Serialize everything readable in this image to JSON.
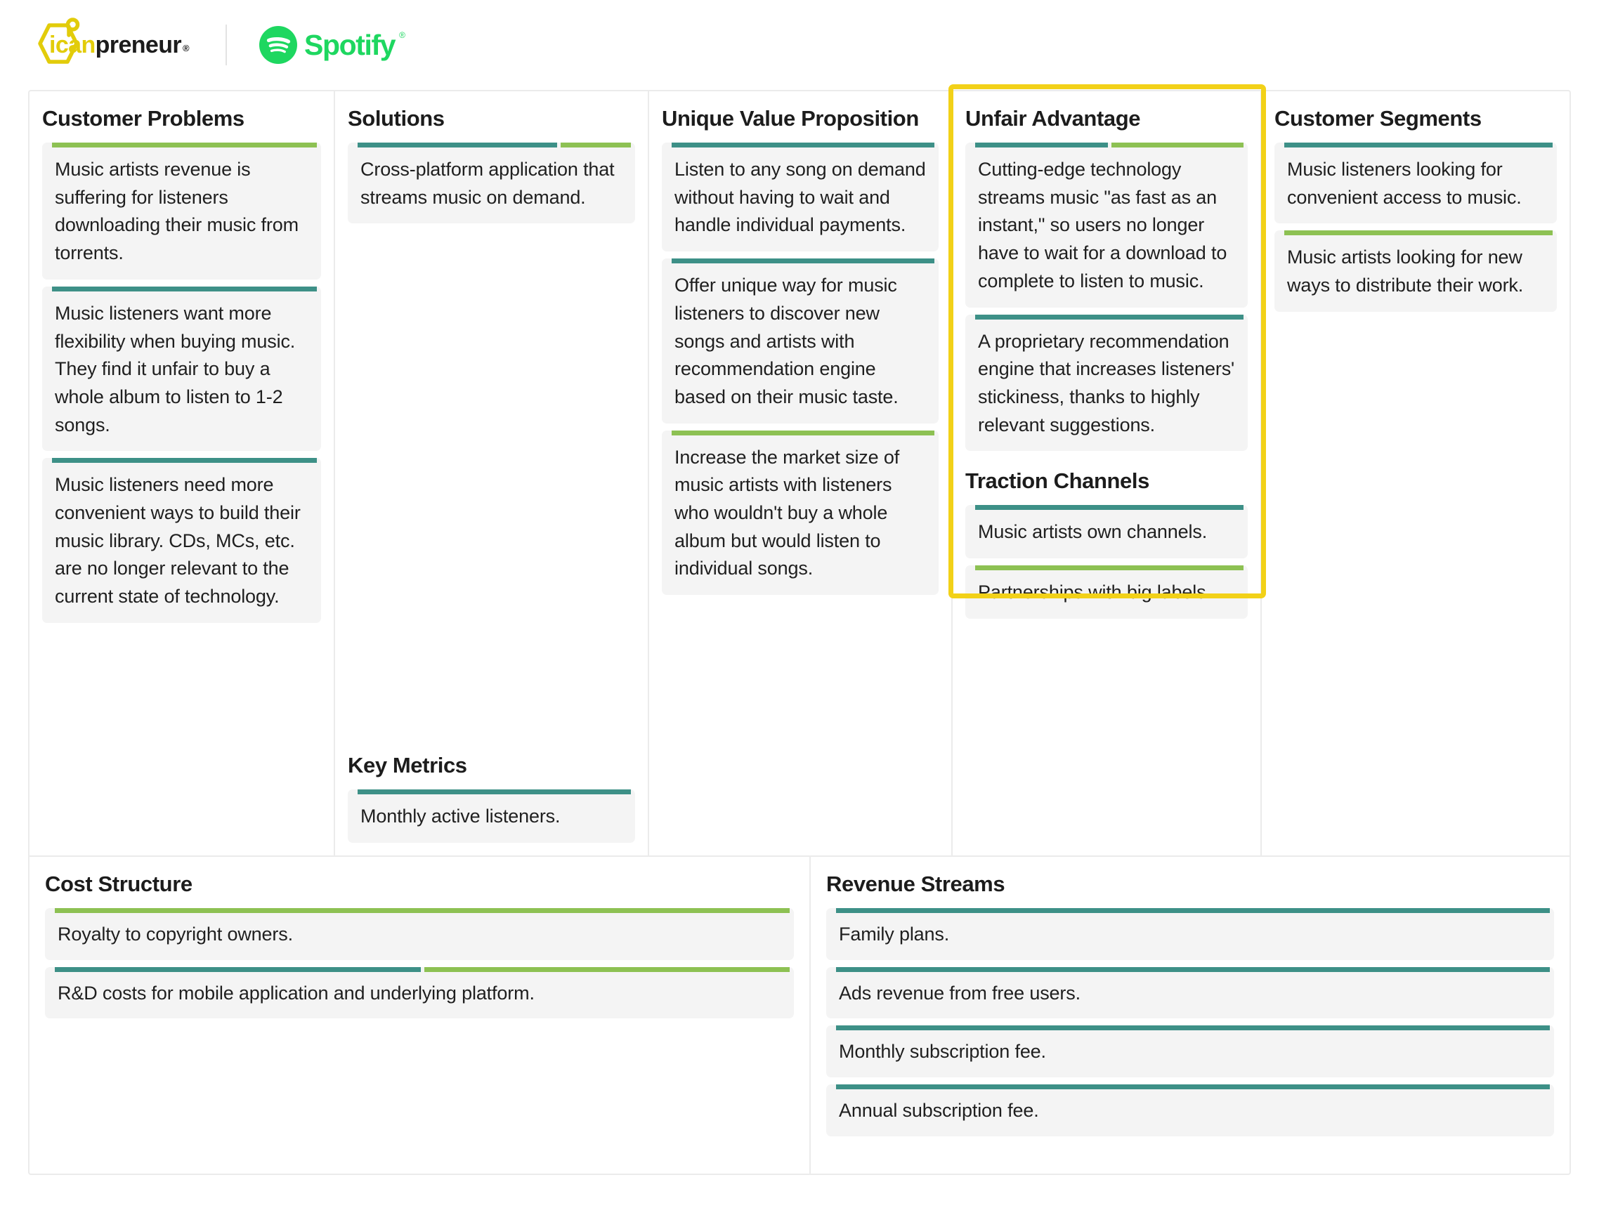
{
  "header": {
    "brand": {
      "part1": "ican",
      "part2": "preneur",
      "registered": "®",
      "icon": "hexagon-key-logo"
    },
    "company": {
      "name": "Spotify",
      "registered": "®",
      "icon": "spotify-icon"
    }
  },
  "colors": {
    "teal": "#3D9087",
    "green": "#8DC153",
    "highlight_yellow": "#F2D118",
    "brand_yellow": "#E2CC0A",
    "spotify_green": "#1ED760",
    "card_bg": "#f4f4f4",
    "grid_line": "#ebebeb"
  },
  "canvas": {
    "customer_problems": {
      "title": "Customer Problems",
      "cards": [
        {
          "text": "Music artists revenue is suffering for listeners downloading their music from torrents.",
          "bar": [
            {
              "color": "green",
              "flex": 1
            }
          ]
        },
        {
          "text": "Music listeners want more flexibility when buying music. They find it unfair to buy a whole album to listen to 1-2 songs.",
          "bar": [
            {
              "color": "teal",
              "flex": 1
            }
          ]
        },
        {
          "text": "Music listeners need more convenient ways to build their music library. CDs, MCs, etc. are no longer relevant to the current state of technology.",
          "bar": [
            {
              "color": "teal",
              "flex": 1
            }
          ]
        }
      ]
    },
    "solutions": {
      "title": "Solutions",
      "cards": [
        {
          "text": "Cross-platform application that streams music on demand.",
          "bar": [
            {
              "color": "teal",
              "flex": 74
            },
            {
              "color": "green",
              "flex": 26
            }
          ]
        }
      ]
    },
    "key_metrics": {
      "title": "Key Metrics",
      "cards": [
        {
          "text": "Monthly active listeners.",
          "bar": [
            {
              "color": "teal",
              "flex": 1
            }
          ]
        }
      ]
    },
    "unique_value_proposition": {
      "title": "Unique Value Proposition",
      "cards": [
        {
          "text": "Listen to any song on demand without having to wait and handle individual payments.",
          "bar": [
            {
              "color": "teal",
              "flex": 1
            }
          ]
        },
        {
          "text": "Offer unique way for music listeners to discover new songs and artists with recommendation engine based on their music taste.",
          "bar": [
            {
              "color": "teal",
              "flex": 1
            }
          ]
        },
        {
          "text": "Increase the market size of music artists with listeners who wouldn't buy a whole album but would listen to individual songs.",
          "bar": [
            {
              "color": "green",
              "flex": 1
            }
          ]
        }
      ]
    },
    "unfair_advantage": {
      "title": "Unfair Advantage",
      "highlighted": true,
      "cards": [
        {
          "text": "Cutting-edge technology streams music \"as fast as an instant,\" so users no longer have to wait for a download to complete to listen to music.",
          "bar": [
            {
              "color": "teal",
              "flex": 50
            },
            {
              "color": "green",
              "flex": 50
            }
          ]
        },
        {
          "text": "A proprietary recommendation engine that increases listeners' stickiness, thanks to highly relevant suggestions.",
          "bar": [
            {
              "color": "teal",
              "flex": 1
            }
          ]
        }
      ]
    },
    "traction_channels": {
      "title": "Traction Channels",
      "cards": [
        {
          "text": "Music artists own channels.",
          "bar": [
            {
              "color": "teal",
              "flex": 1
            }
          ]
        },
        {
          "text": "Partnerships with big labels.",
          "bar": [
            {
              "color": "green",
              "flex": 1
            }
          ]
        }
      ]
    },
    "customer_segments": {
      "title": "Customer Segments",
      "cards": [
        {
          "text": "Music listeners looking for convenient access to music.",
          "bar": [
            {
              "color": "teal",
              "flex": 1
            }
          ]
        },
        {
          "text": "Music artists looking for new ways to distribute their work.",
          "bar": [
            {
              "color": "green",
              "flex": 1
            }
          ]
        }
      ]
    },
    "cost_structure": {
      "title": "Cost Structure",
      "cards": [
        {
          "text": "Royalty to copyright owners.",
          "bar": [
            {
              "color": "green",
              "flex": 1
            }
          ]
        },
        {
          "text": "R&D costs for mobile application and underlying platform.",
          "bar": [
            {
              "color": "teal",
              "flex": 50
            },
            {
              "color": "green",
              "flex": 50
            }
          ]
        }
      ]
    },
    "revenue_streams": {
      "title": "Revenue Streams",
      "cards": [
        {
          "text": "Family plans.",
          "bar": [
            {
              "color": "teal",
              "flex": 1
            }
          ]
        },
        {
          "text": "Ads revenue from free users.",
          "bar": [
            {
              "color": "teal",
              "flex": 1
            }
          ]
        },
        {
          "text": "Monthly subscription fee.",
          "bar": [
            {
              "color": "teal",
              "flex": 1
            }
          ]
        },
        {
          "text": "Annual subscription fee.",
          "bar": [
            {
              "color": "teal",
              "flex": 1
            }
          ]
        }
      ]
    }
  }
}
